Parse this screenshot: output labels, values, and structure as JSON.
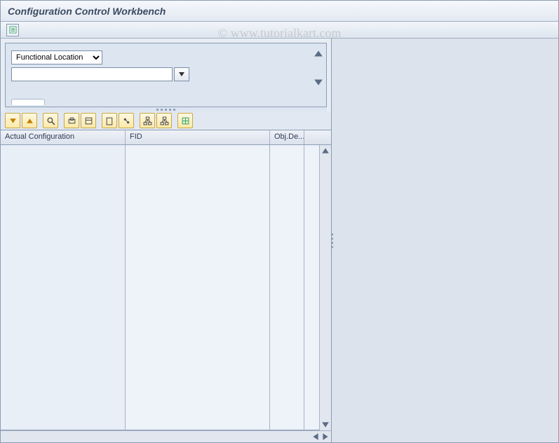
{
  "window": {
    "title": "Configuration Control Workbench"
  },
  "watermark": "© www.tutorialkart.com",
  "selector": {
    "dropdown_value": "Functional Location",
    "input_value": ""
  },
  "toolbar": {
    "btn_expand": "expand",
    "btn_collapse": "collapse",
    "btn_find": "find",
    "btn_print": "print",
    "btn_layout": "layout",
    "btn_create": "create",
    "btn_link": "link",
    "btn_hier1": "hierarchy-1",
    "btn_hier2": "hierarchy-2",
    "btn_detail": "detail"
  },
  "grid": {
    "columns": {
      "col1": "Actual Configuration",
      "col2": "FID",
      "col3": "Obj.De..."
    },
    "rows": []
  }
}
